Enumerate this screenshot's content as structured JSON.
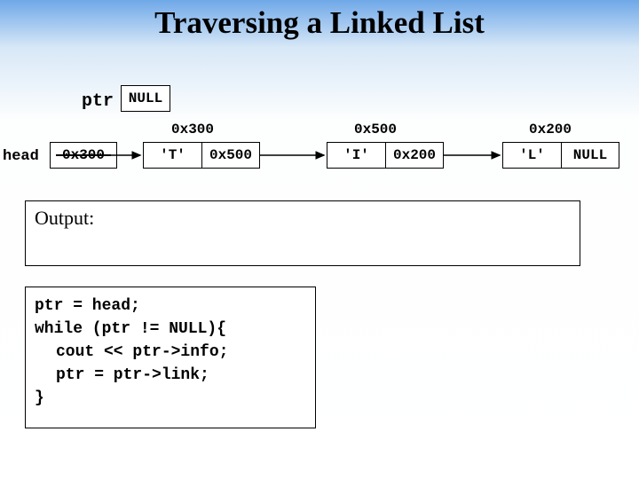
{
  "title": "Traversing a Linked List",
  "ptr": {
    "label": "ptr",
    "value": "NULL"
  },
  "head": {
    "label": "head",
    "value": "0x300"
  },
  "addresses": {
    "n1": "0x300",
    "n2": "0x500",
    "n3": "0x200"
  },
  "nodes": {
    "n1": {
      "info": "'T'",
      "link": "0x500"
    },
    "n2": {
      "info": "'I'",
      "link": "0x200"
    },
    "n3": {
      "info": "'L'",
      "link": "NULL"
    }
  },
  "output": {
    "label": "Output:"
  },
  "code": {
    "l1": "ptr  =  head;",
    "l2": "while (ptr != NULL){",
    "l3": "cout  <<  ptr->info;",
    "l4": "ptr  =  ptr->link;",
    "l5": "}"
  }
}
